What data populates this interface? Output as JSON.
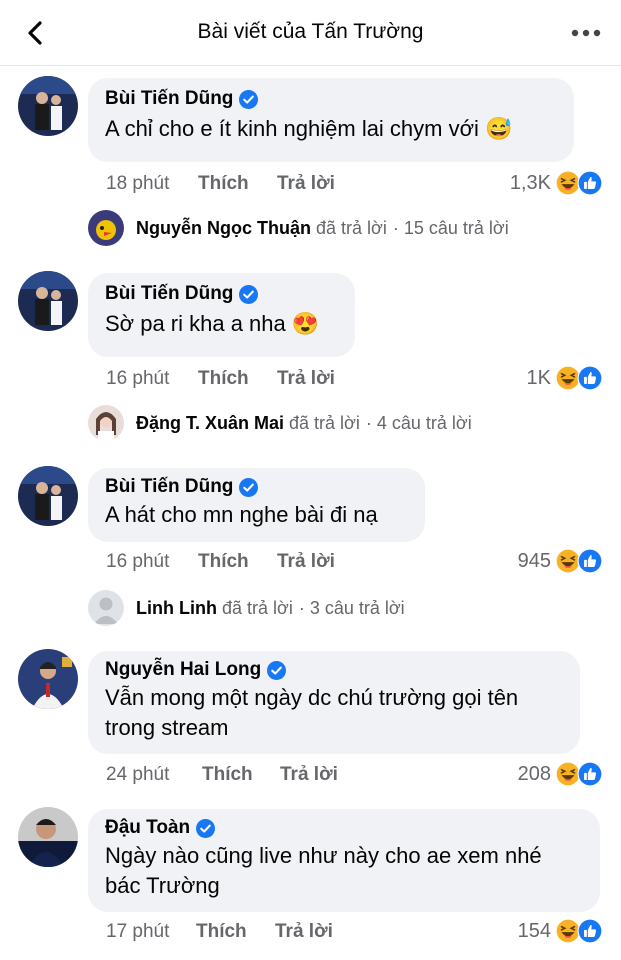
{
  "header": {
    "title": "Bài viết của Tấn Trường"
  },
  "comments": [
    {
      "name": "Bùi Tiến Dũng",
      "text": "A chỉ cho e ít kinh nghiệm lai chym với",
      "emoji": "😅",
      "time": "18 phút",
      "like": "Thích",
      "reply": "Trả lời",
      "reactions": "1,3K",
      "replies": {
        "name": "Nguyễn Ngọc Thuận",
        "action": "đã trả lời",
        "count": "· 15 câu trả lời"
      }
    },
    {
      "name": "Bùi Tiến Dũng",
      "text": "Sờ pa ri kha a nha",
      "emoji": "😍",
      "time": "16 phút",
      "like": "Thích",
      "reply": "Trả lời",
      "reactions": "1K",
      "replies": {
        "name": "Đặng T. Xuân Mai",
        "action": "đã trả lời",
        "count": "· 4 câu trả lời"
      }
    },
    {
      "name": "Bùi Tiến Dũng",
      "text": "A hát cho mn nghe bài đi nạ",
      "emoji": "",
      "time": "16 phút",
      "like": "Thích",
      "reply": "Trả lời",
      "reactions": "945",
      "replies": {
        "name": "Linh Linh",
        "action": "đã trả lời",
        "count": "· 3 câu trả lời"
      }
    },
    {
      "name": "Nguyễn Hai Long",
      "text": "Vẫn mong một ngày dc chú trường gọi tên trong stream",
      "emoji": "",
      "time": "24 phút",
      "like": "Thích",
      "reply": "Trả lời",
      "reactions": "208"
    },
    {
      "name": "Đậu Toàn",
      "text": "Ngày nào cũng live như này cho ae xem nhé bác Trường",
      "emoji": "",
      "time": "17 phút",
      "like": "Thích",
      "reply": "Trả lời",
      "reactions": "154"
    }
  ],
  "colors": {
    "verified": "#1877f2",
    "like": "#1877f2",
    "haha": "#f7b125",
    "bubble": "#f0f2f5"
  }
}
